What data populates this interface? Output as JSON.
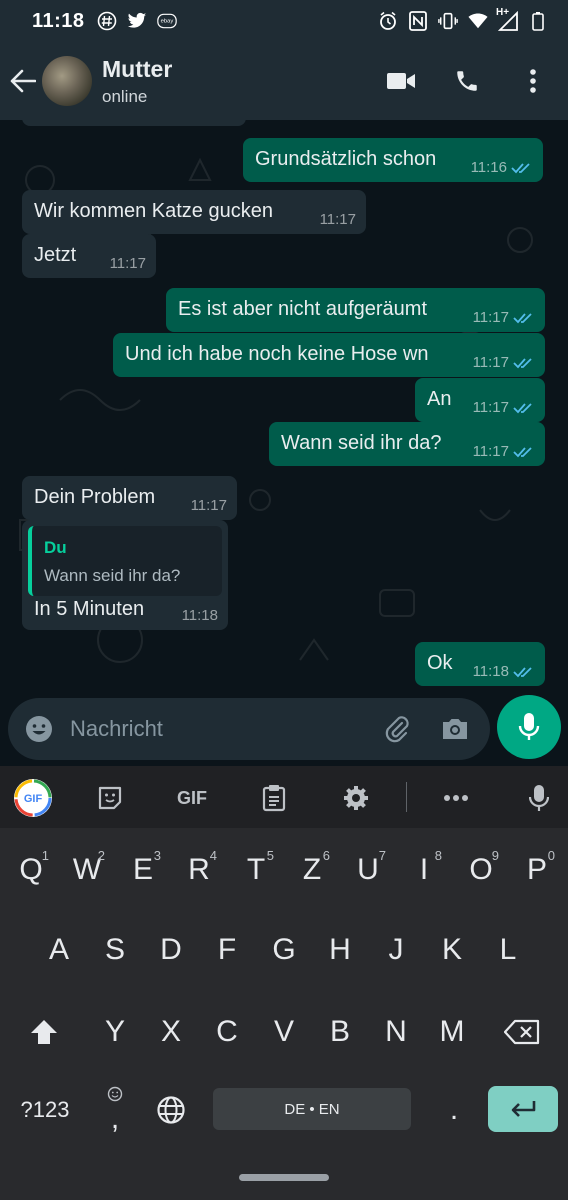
{
  "status_bar": {
    "time": "11:18",
    "left_icons": [
      "hashtag-icon",
      "twitter-icon",
      "ebay-kleinanzeigen-icon"
    ],
    "right_icons": [
      "alarm-icon",
      "nfc-icon",
      "vibrate-icon",
      "wifi-icon",
      "signal-icon",
      "battery-icon"
    ],
    "network": "H+"
  },
  "header": {
    "title": "Mutter",
    "subtitle": "online",
    "actions": [
      "video-call-icon",
      "phone-icon",
      "more-vert-icon"
    ]
  },
  "messages": [
    {
      "dir": "out",
      "text": "Grundsätzlich schon",
      "time": "11:16",
      "status": "read"
    },
    {
      "dir": "in",
      "text": "Wir kommen Katze gucken",
      "time": "11:17"
    },
    {
      "dir": "in",
      "text": "Jetzt",
      "time": "11:17"
    },
    {
      "dir": "out",
      "text": "Es ist aber nicht aufgeräumt",
      "time": "11:17",
      "status": "read"
    },
    {
      "dir": "out",
      "text": "Und ich habe noch keine Hose wn",
      "time": "11:17",
      "status": "read"
    },
    {
      "dir": "out",
      "text": "An",
      "time": "11:17",
      "status": "read"
    },
    {
      "dir": "out",
      "text": "Wann seid ihr da?",
      "time": "11:17",
      "status": "read"
    },
    {
      "dir": "in",
      "text": "Dein Problem",
      "time": "11:17"
    },
    {
      "dir": "in",
      "text": "In 5 Minuten",
      "time": "11:18",
      "quote": {
        "author": "Du",
        "text": "Wann seid ihr da?"
      }
    },
    {
      "dir": "out",
      "text": "Ok",
      "time": "11:18",
      "status": "read"
    }
  ],
  "composer": {
    "placeholder": "Nachricht"
  },
  "keyboard": {
    "toolbar": [
      "google-icon",
      "sticker-icon",
      "gif-label",
      "clipboard-icon",
      "settings-icon",
      "more-icon",
      "mic-icon"
    ],
    "gif_label": "GIF",
    "row1": [
      {
        "k": "Q",
        "n": "1"
      },
      {
        "k": "W",
        "n": "2"
      },
      {
        "k": "E",
        "n": "3"
      },
      {
        "k": "R",
        "n": "4"
      },
      {
        "k": "T",
        "n": "5"
      },
      {
        "k": "Z",
        "n": "6"
      },
      {
        "k": "U",
        "n": "7"
      },
      {
        "k": "I",
        "n": "8"
      },
      {
        "k": "O",
        "n": "9"
      },
      {
        "k": "P",
        "n": "0"
      }
    ],
    "row2": [
      "A",
      "S",
      "D",
      "F",
      "G",
      "H",
      "J",
      "K",
      "L"
    ],
    "row3": [
      "Y",
      "X",
      "C",
      "V",
      "B",
      "N",
      "M"
    ],
    "symbols_key": "?123",
    "comma_key": ",",
    "space_label": "DE • EN",
    "period_key": "."
  },
  "colors": {
    "app_bar": "#1f2c34",
    "chat_bg": "#0b141a",
    "bubble_in": "#1f2c34",
    "bubble_out": "#005c4b",
    "accent": "#00a884",
    "read_ticks": "#53bdeb"
  }
}
